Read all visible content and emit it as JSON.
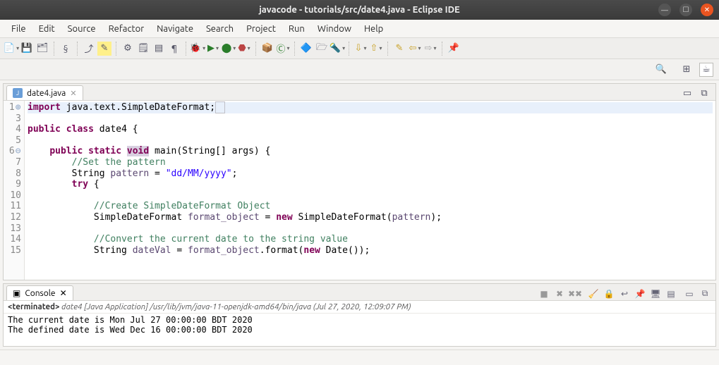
{
  "window": {
    "title": "javacode - tutorials/src/date4.java - Eclipse IDE"
  },
  "menu": {
    "file": "File",
    "edit": "Edit",
    "source": "Source",
    "refactor": "Refactor",
    "navigate": "Navigate",
    "search": "Search",
    "project": "Project",
    "run": "Run",
    "window": "Window",
    "help": "Help"
  },
  "editor": {
    "tab_label": "date4.java",
    "lines": {
      "l1": "1",
      "l3": "3",
      "l4": "4",
      "l5": "5",
      "l6": "6",
      "l7": "7",
      "l8": "8",
      "l9": "9",
      "l10": "10",
      "l11": "11",
      "l12": "12",
      "l13": "13",
      "l14": "14",
      "l15": "15"
    },
    "code": {
      "l1_import": "import",
      "l1_rest": " java.text.SimpleDateFormat;",
      "l4_public": "public",
      "l4_class": "class",
      "l4_name": " date4 {",
      "l6_public": "public",
      "l6_static": "static",
      "l6_void": "void",
      "l6_rest": " main(String[] args) {",
      "l7_cmt": "//Set the pattern",
      "l8_a": "String ",
      "l8_id": "pattern",
      "l8_b": " = ",
      "l8_str": "\"dd/MM/yyyy\"",
      "l8_c": ";",
      "l9_try": "try",
      "l9_b": " {",
      "l11_cmt": "//Create SimpleDateFormat Object",
      "l12_a": "SimpleDateFormat ",
      "l12_id": "format_object",
      "l12_b": " = ",
      "l12_new": "new",
      "l12_c": " SimpleDateFormat(",
      "l12_arg": "pattern",
      "l12_d": ");",
      "l14_cmt": "//Convert the current date to the string value",
      "l15_a": "String ",
      "l15_id": "dateVal",
      "l15_b": " = ",
      "l15_id2": "format_object",
      "l15_c": ".format(",
      "l15_new": "new",
      "l15_d": " Date());"
    }
  },
  "console": {
    "tab_label": "Console",
    "status_prefix": "<terminated>",
    "status_main": " date4 [Java Application] /usr/lib/jvm/java-11-openjdk-amd64/bin/java (Jul 27, 2020, 12:09:07 PM)",
    "out_line1": "The current date is Mon Jul 27 00:00:00 BDT 2020",
    "out_line2": "The defined date is Wed Dec 16 00:00:00 BDT 2020"
  },
  "icons": {
    "search": "🔍",
    "new": "📄",
    "save": "💾",
    "saveall": "🗂",
    "debug": "🐞",
    "run": "▶",
    "ext": "⧉",
    "stop": "⏹",
    "package": "📦",
    "open_type": "🔷",
    "task": "🗒",
    "nav_back": "⇦",
    "nav_fwd": "⇨",
    "pin": "📌",
    "min": "—",
    "max": "☐",
    "close": "✕",
    "cons": "▣",
    "x": "✖",
    "xx": "✖✖",
    "scroll_lock": "🔒",
    "clear": "🧹",
    "display": "🖥"
  }
}
